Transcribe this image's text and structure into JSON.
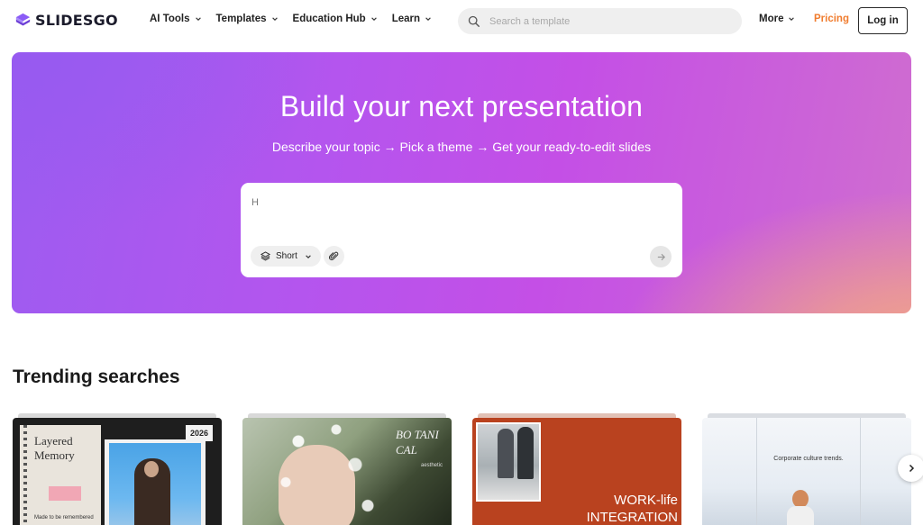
{
  "brand": {
    "name": "SLIDESGO",
    "accent": "#f07c2e"
  },
  "nav": {
    "items": [
      {
        "label": "AI Tools"
      },
      {
        "label": "Templates"
      },
      {
        "label": "Education Hub"
      },
      {
        "label": "Learn"
      }
    ],
    "more_label": "More",
    "pricing_label": "Pricing",
    "login_label": "Log in"
  },
  "search": {
    "placeholder": "Search a template",
    "icon": "search-icon"
  },
  "hero": {
    "title": "Build your next presentation",
    "subtitle": "Describe your topic → Pick a theme → Get your ready-to-edit slides",
    "prompt_value": "H",
    "length_label": "Short"
  },
  "trending": {
    "title": "Trending searches",
    "cards": [
      {
        "title": "Layered Memory",
        "tag": "2026",
        "note": "Made to be remembered"
      },
      {
        "title": "BO TANI CAL",
        "note": "aesthetic"
      },
      {
        "title": "WORK-life INTEGRATION"
      },
      {
        "title": "Corporate culture trends."
      }
    ]
  }
}
